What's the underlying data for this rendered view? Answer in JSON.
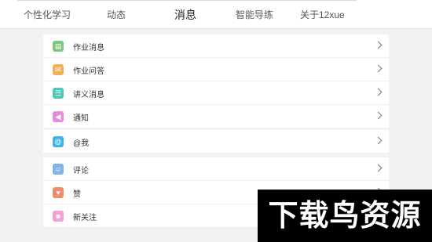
{
  "tabs": [
    {
      "label": "个性化学习"
    },
    {
      "label": "动态"
    },
    {
      "label": "消息",
      "active": true
    },
    {
      "label": "智能导练"
    },
    {
      "label": "关于12xue"
    }
  ],
  "groups": [
    {
      "items": [
        {
          "label": "作业消息",
          "icon": "homework-message-icon",
          "color": "#7cc87a"
        },
        {
          "label": "作业问答",
          "icon": "homework-qa-icon",
          "color": "#f0b15b"
        },
        {
          "label": "讲义消息",
          "icon": "handout-message-icon",
          "color": "#4fc8b8"
        },
        {
          "label": "通知",
          "icon": "notification-icon",
          "color": "#e58ce0"
        }
      ]
    },
    {
      "items": [
        {
          "label": "@我",
          "icon": "mention-icon",
          "color": "#39b6e6"
        }
      ]
    },
    {
      "items": [
        {
          "label": "评论",
          "icon": "comment-icon",
          "color": "#7fb3ea"
        },
        {
          "label": "赞",
          "icon": "like-icon",
          "color": "#f08a6c"
        },
        {
          "label": "新关注",
          "icon": "new-follower-icon",
          "color": "#f3a0d7"
        }
      ]
    }
  ],
  "watermark": {
    "text": "下载鸟资源"
  }
}
